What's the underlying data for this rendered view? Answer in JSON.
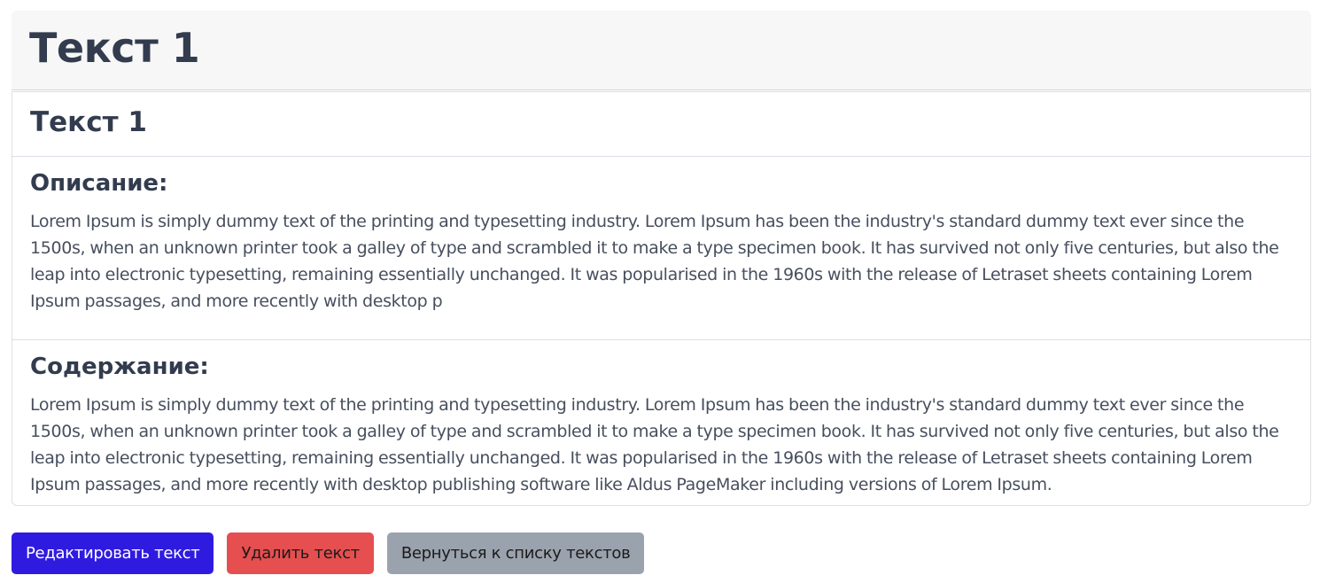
{
  "header": {
    "title": "Текст 1"
  },
  "card": {
    "title": "Текст 1",
    "description": {
      "heading": "Описание:",
      "text": "Lorem Ipsum is simply dummy text of the printing and typesetting industry. Lorem Ipsum has been the industry's standard dummy text ever since the 1500s, when an unknown printer took a galley of type and scrambled it to make a type specimen book. It has survived not only five centuries, but also the leap into electronic typesetting, remaining essentially unchanged. It was popularised in the 1960s with the release of Letraset sheets containing Lorem Ipsum passages, and more recently with desktop p"
    },
    "content": {
      "heading": "Содержание:",
      "text": "Lorem Ipsum is simply dummy text of the printing and typesetting industry. Lorem Ipsum has been the industry's standard dummy text ever since the 1500s, when an unknown printer took a galley of type and scrambled it to make a type specimen book. It has survived not only five centuries, but also the leap into electronic typesetting, remaining essentially unchanged. It was popularised in the 1960s with the release of Letraset sheets containing Lorem Ipsum passages, and more recently with desktop publishing software like Aldus PageMaker including versions of Lorem Ipsum."
    }
  },
  "actions": {
    "edit_label": "Редактировать текст",
    "delete_label": "Удалить текст",
    "back_label": "Вернуться к списку текстов"
  },
  "colors": {
    "edit_button": "#2f1be0",
    "delete_button": "#e54f50",
    "back_button": "#9aa2ad",
    "header_background": "#f7f7f7"
  }
}
